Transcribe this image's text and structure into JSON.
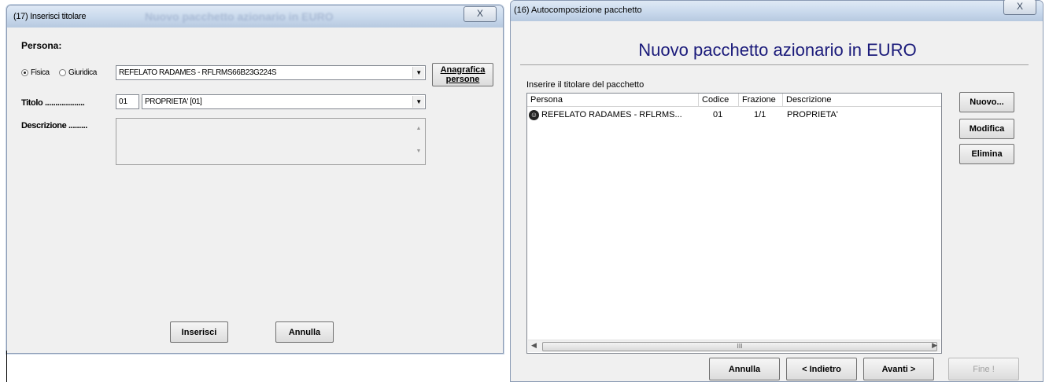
{
  "left_dialog": {
    "title": "(17) Inserisci titolare",
    "background_title": "Nuovo pacchetto azionario in EURO",
    "persona_label": "Persona:",
    "radio_fisica": "Fisica",
    "radio_giuridica": "Giuridica",
    "persona_value": "REFELATO RADAMES - RFLRMS66B23G224S",
    "anagrafica_button_line1": "Anagrafica",
    "anagrafica_button_line2": "persone",
    "titolo_label": "Titolo ...................",
    "titolo_code": "01",
    "titolo_value": "PROPRIETA' [01]",
    "descrizione_label": "Descrizione .........",
    "descrizione_value": "",
    "inserisci_button": "Inserisci",
    "annulla_button": "Annulla",
    "close_glyph": "X"
  },
  "right_dialog": {
    "title": "(16) Autocomposizione pacchetto",
    "heading": "Nuovo pacchetto azionario in EURO",
    "instruction": "Inserire il titolare del pacchetto",
    "columns": [
      "Persona",
      "Codice",
      "Frazione",
      "Descrizione"
    ],
    "rows": [
      {
        "persona": "REFELATO RADAMES - RFLRMS...",
        "codice": "01",
        "frazione": "1/1",
        "descrizione": "PROPRIETA'"
      }
    ],
    "scroll_thumb": "III",
    "nuovo_button": "Nuovo...",
    "modifica_button": "Modifica",
    "elimina_button": "Elimina",
    "annulla_button": "Annulla",
    "indietro_button": "< Indietro",
    "avanti_button": "Avanti >",
    "fine_button": "Fine !",
    "close_glyph": "X"
  }
}
